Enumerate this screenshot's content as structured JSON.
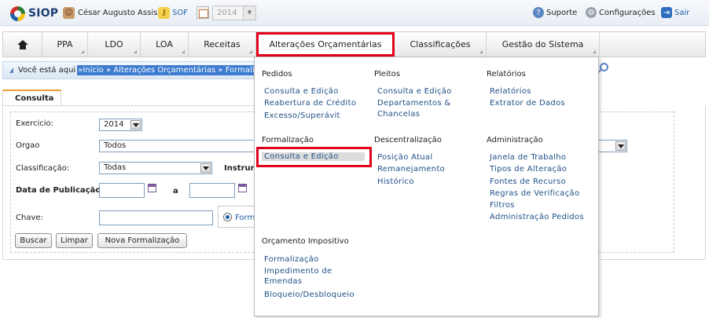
{
  "header": {
    "logo_text": "SIOP",
    "user_name": "César Augusto Assis",
    "sof_label": "SOF",
    "year": "2014",
    "links": {
      "suporte": "Suporte",
      "configuracoes": "Configurações",
      "sair": "Sair"
    }
  },
  "nav": {
    "items": [
      "PPA",
      "LDO",
      "LOA",
      "Receitas",
      "Alterações Orçamentárias",
      "Classificações",
      "Gestão do Sistema"
    ],
    "active": "Alterações Orçamentárias"
  },
  "breadcrumb": {
    "label": "Você está aqui",
    "path": "»Início » Alterações Orçamentárias » Formaliza"
  },
  "form": {
    "tab": "Consulta",
    "exercicio_label": "Exercicio:",
    "exercicio_value": "2014",
    "orgao_label": "Orgao",
    "orgao_value": "Todos",
    "classificacao_label": "Classificação:",
    "classificacao_value": "Todas",
    "instrumento_label": "Instrum",
    "data_publicacao_label": "Data de Publicação:",
    "data_separator": "a",
    "chave_label": "Chave:",
    "radio_label": "Form",
    "buttons": {
      "buscar": "Buscar",
      "limpar": "Limpar",
      "nova": "Nova Formalização"
    }
  },
  "dropdown": {
    "pedidos": {
      "title": "Pedidos",
      "items": [
        "Consulta e Edição",
        "Reabertura de Crédito",
        "Excesso/Superávit"
      ]
    },
    "pleitos": {
      "title": "Pleitos",
      "items": [
        "Consulta e Edição",
        "Departamentos &",
        "Chancelas"
      ]
    },
    "relatorios": {
      "title": "Relatórios",
      "items": [
        "Relatórios",
        "Extrator de Dados"
      ]
    },
    "formalizacao": {
      "title": "Formalização",
      "items": [
        "Consulta e Edição"
      ]
    },
    "descentralizacao": {
      "title": "Descentralização",
      "items": [
        "Posição Atual",
        "Remanejamento",
        "Histórico"
      ]
    },
    "administracao": {
      "title": "Administração",
      "items": [
        "Janela de Trabalho",
        "Tipos de Alteração",
        "Fontes de Recurso",
        "Regras de Verificação",
        "Filtros",
        "Administração Pedidos"
      ]
    },
    "impositivo": {
      "title": "Orçamento Impositivo",
      "items": [
        "Formalização",
        "Impedimento de",
        "Emendas",
        "Bloqueio/Desbloqueio"
      ]
    }
  },
  "colors": {
    "highlight": "#e1001a",
    "link": "#1f4f86",
    "breadcrumb_selection": "#3d7bd0"
  }
}
